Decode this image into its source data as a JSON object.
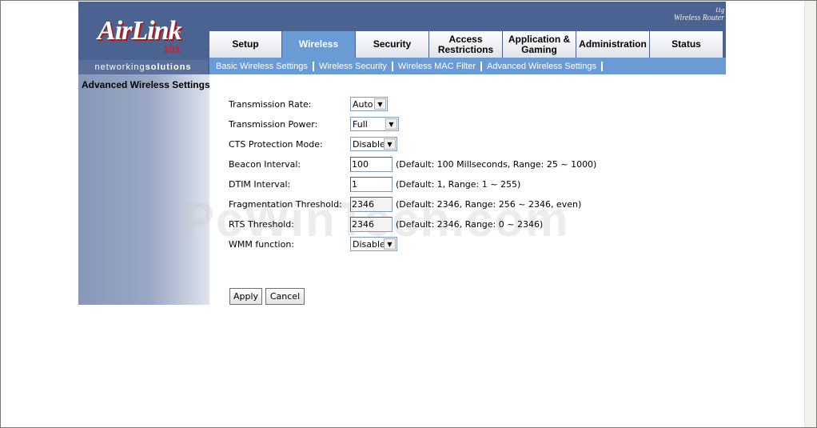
{
  "brand": {
    "logo_text": "AirLink",
    "logo_number": "101",
    "logo_tm": "™",
    "tagline_light": "networking",
    "tagline_bold": "solutions",
    "top_right_line1": "11g",
    "top_right_line2": "Wireless Router"
  },
  "tabs": [
    {
      "label": "Setup"
    },
    {
      "label": "Wireless",
      "active": true
    },
    {
      "label": "Security"
    },
    {
      "label": "Access Restrictions"
    },
    {
      "label": "Application & Gaming"
    },
    {
      "label": "Administration"
    },
    {
      "label": "Status"
    }
  ],
  "subnav": [
    {
      "label": "Basic Wireless Settings"
    },
    {
      "label": "Wireless Security"
    },
    {
      "label": "Wireless MAC Filter"
    },
    {
      "label": "Advanced Wireless Settings"
    }
  ],
  "section_title": "Advanced Wireless Settings",
  "form": {
    "transmission_rate": {
      "label": "Transmission Rate:",
      "value": "Auto"
    },
    "transmission_power": {
      "label": "Transmission Power:",
      "value": "Full"
    },
    "cts_protection": {
      "label": "CTS Protection Mode:",
      "value": "Disable"
    },
    "beacon_interval": {
      "label": "Beacon Interval:",
      "value": "100",
      "hint": "(Default: 100 Millseconds, Range: 25 ~ 1000)"
    },
    "dtim_interval": {
      "label": "DTIM Interval:",
      "value": "1",
      "hint": "(Default: 1, Range: 1 ~ 255)"
    },
    "fragmentation_threshold": {
      "label": "Fragmentation Threshold:",
      "value": "2346",
      "hint": "(Default: 2346, Range: 256 ~ 2346, even)"
    },
    "rts_threshold": {
      "label": "RTS Threshold:",
      "value": "2346",
      "hint": "(Default: 2346, Range: 0 ~ 2346)"
    },
    "wmm_function": {
      "label": "WMM function:",
      "value": "Disable"
    }
  },
  "buttons": {
    "apply": "Apply",
    "cancel": "Cancel"
  },
  "watermark": "PcWinTech.com"
}
